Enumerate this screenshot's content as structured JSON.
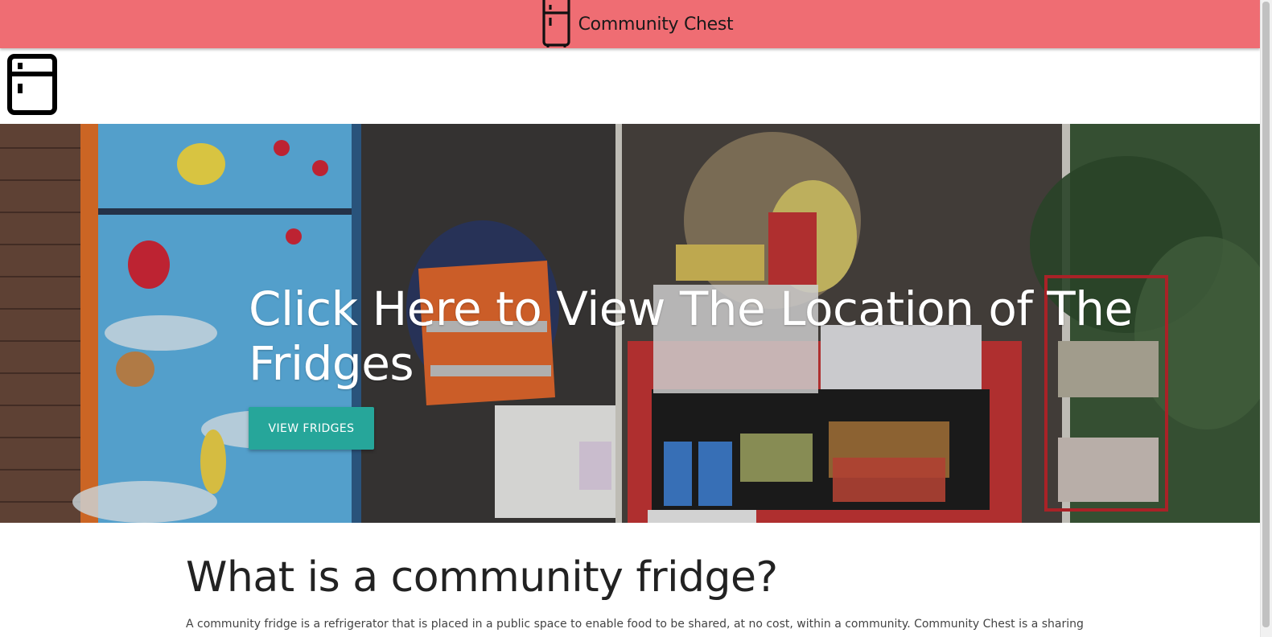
{
  "header": {
    "brand_name": "Community Chest",
    "brand_icon": "fridge-icon",
    "background_color": "#ef6d73"
  },
  "nav": {
    "logo_icon": "fridge-icon"
  },
  "hero": {
    "title": "Click Here to View The Location of The Fridges",
    "button_label": "VIEW FRIDGES",
    "button_color": "#26a69a"
  },
  "about": {
    "title": "What is a community fridge?",
    "text": "A community fridge is a refrigerator that is placed in a public space to enable food to be shared, at no cost, within a community. Community Chest is a sharing"
  }
}
